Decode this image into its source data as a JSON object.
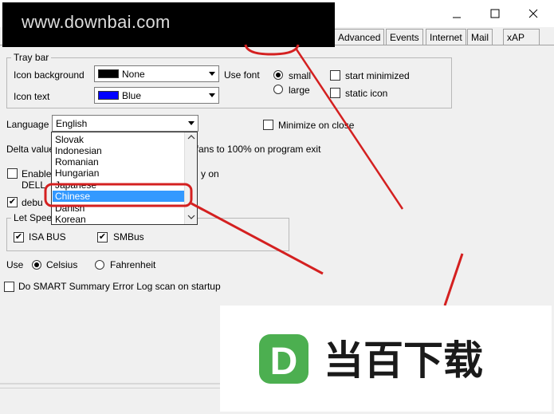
{
  "watermark": "www.downbai.com",
  "tabs": [
    "Advanced",
    "Events",
    "Internet",
    "Mail",
    "xAP"
  ],
  "tray": {
    "group_label": "Tray bar",
    "icon_background_label": "Icon background",
    "icon_background_value": "None",
    "icon_background_color": "#000000",
    "icon_text_label": "Icon text",
    "icon_text_value": "Blue",
    "icon_text_color": "#0000ff",
    "use_font_label": "Use font",
    "small_label": "small",
    "large_label": "large",
    "start_minimized_label": "start minimized",
    "static_icon_label": "static icon"
  },
  "language": {
    "label": "Language",
    "value": "English",
    "options": [
      "Slovak",
      "Indonesian",
      "Romanian",
      "Hungarian",
      "Japanese",
      "Chinese",
      "Danish",
      "Korean"
    ],
    "selected": "Chinese",
    "minimize_on_close_label": "Minimize on close"
  },
  "delta_label": "Delta value",
  "fans_label": "t fans to 100% on program exit",
  "enable_label": "Enable",
  "enable_label2": "y on",
  "dell_label": "DELL",
  "debug_label": "debu",
  "let_speed": {
    "group_label": "Let Spee",
    "isa_bus_label": "ISA BUS",
    "smbus_label": "SMBus"
  },
  "units": {
    "use_label": "Use",
    "celsius_label": "Celsius",
    "fahrenheit_label": "Fahrenheit"
  },
  "smart_label": "Do SMART Summary Error Log scan on startup",
  "logo": {
    "letter": "D",
    "text": "当百下载",
    "green": "#4caf50",
    "dark": "#1a1a1a"
  },
  "annotation_color": "#d42020"
}
